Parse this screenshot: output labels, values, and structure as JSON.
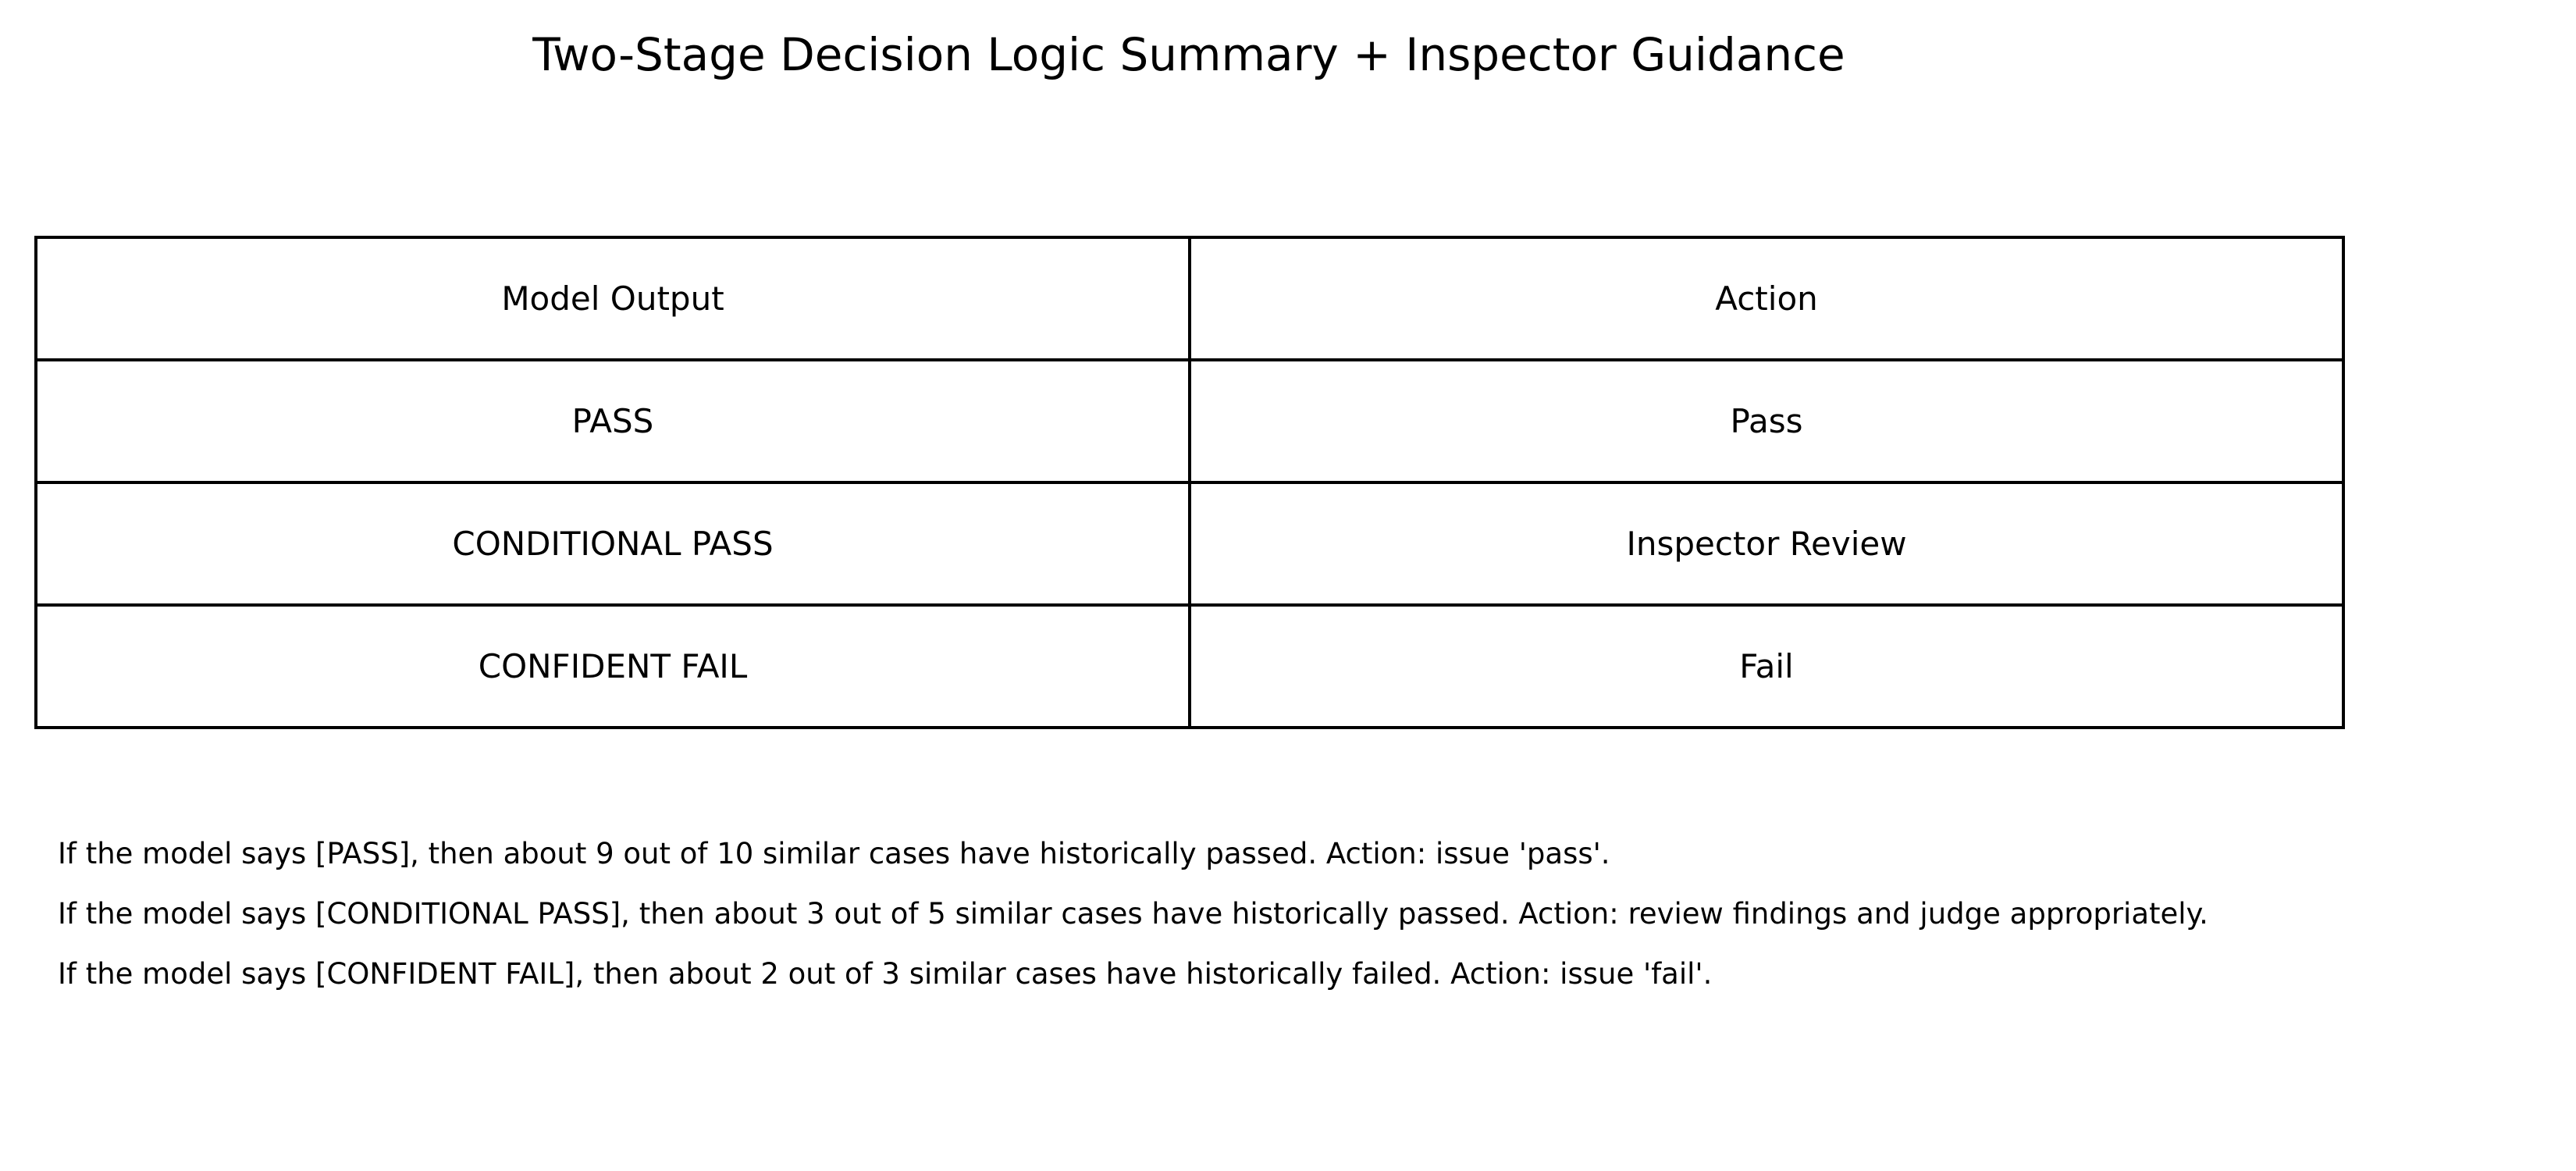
{
  "title": "Two-Stage Decision Logic Summary + Inspector Guidance",
  "table": {
    "headers": [
      "Model Output",
      "Action"
    ],
    "rows": [
      [
        "PASS",
        "Pass"
      ],
      [
        "CONDITIONAL PASS",
        "Inspector Review"
      ],
      [
        "CONFIDENT FAIL",
        "Fail"
      ]
    ]
  },
  "guidance": [
    "If the model says [PASS], then about 9 out of 10 similar cases have historically passed. Action: issue 'pass'.",
    "If the model says [CONDITIONAL PASS], then about 3 out of 5 similar cases have historically passed. Action: review findings and judge appropriately.",
    "If the model says [CONFIDENT FAIL], then about 2 out of 3 similar cases have historically failed. Action: issue 'fail'."
  ]
}
